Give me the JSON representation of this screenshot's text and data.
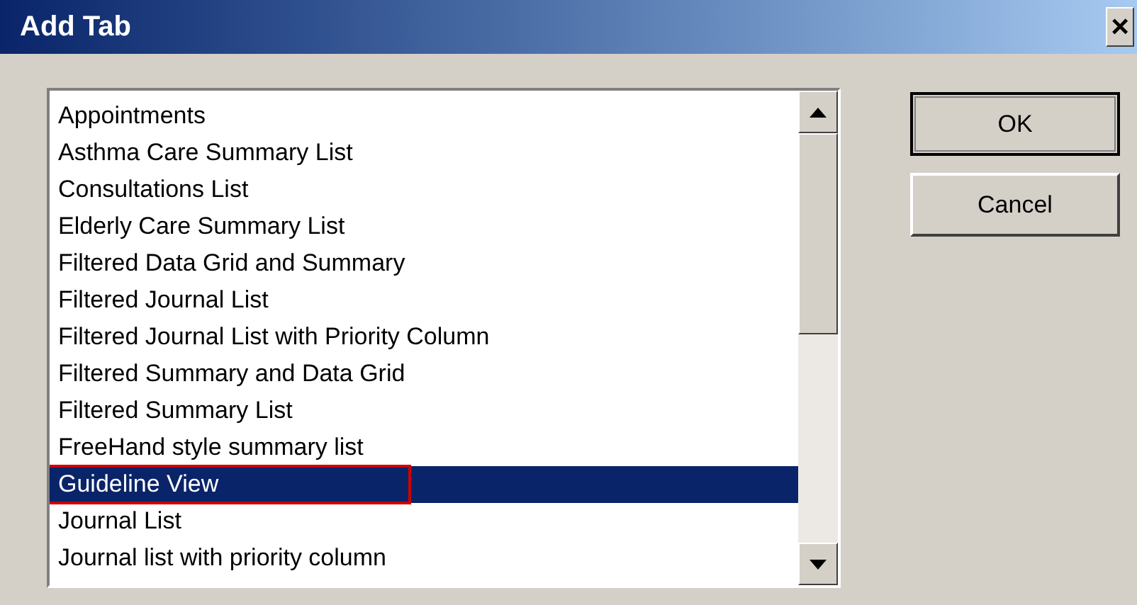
{
  "window": {
    "title": "Add Tab",
    "close": "×"
  },
  "list": {
    "items": [
      {
        "label": "Appointments",
        "selected": false,
        "highlighted": false
      },
      {
        "label": "Asthma Care Summary List",
        "selected": false,
        "highlighted": false
      },
      {
        "label": "Consultations List",
        "selected": false,
        "highlighted": false
      },
      {
        "label": "Elderly Care Summary List",
        "selected": false,
        "highlighted": false
      },
      {
        "label": "Filtered Data Grid and Summary",
        "selected": false,
        "highlighted": false
      },
      {
        "label": "Filtered Journal List",
        "selected": false,
        "highlighted": false
      },
      {
        "label": "Filtered Journal List with Priority Column",
        "selected": false,
        "highlighted": false
      },
      {
        "label": "Filtered Summary and Data Grid",
        "selected": false,
        "highlighted": false
      },
      {
        "label": "Filtered Summary List",
        "selected": false,
        "highlighted": false
      },
      {
        "label": "FreeHand style summary list",
        "selected": false,
        "highlighted": false
      },
      {
        "label": "Guideline View",
        "selected": true,
        "highlighted": true
      },
      {
        "label": "Journal List",
        "selected": false,
        "highlighted": false
      },
      {
        "label": "Journal list with priority column",
        "selected": false,
        "highlighted": false
      }
    ]
  },
  "buttons": [
    {
      "label": "OK",
      "default": true
    },
    {
      "label": "Cancel",
      "default": false
    }
  ]
}
